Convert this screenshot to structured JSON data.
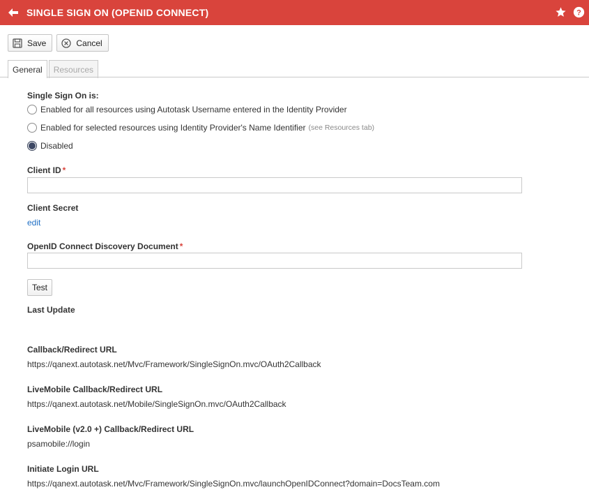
{
  "header": {
    "title": "SINGLE SIGN ON (OPENID CONNECT)",
    "icons": [
      "back-arrow-icon",
      "star-icon",
      "help-icon"
    ],
    "color": "#d9443c"
  },
  "toolbar": {
    "save_label": "Save",
    "cancel_label": "Cancel"
  },
  "tabs": [
    {
      "label": "General",
      "active": true
    },
    {
      "label": "Resources",
      "active": false
    }
  ],
  "sso": {
    "heading": "Single Sign On is:",
    "options": [
      {
        "label": "Enabled for all resources using Autotask Username entered in the Identity Provider",
        "hint": "",
        "checked": false
      },
      {
        "label": "Enabled for selected resources using Identity Provider's Name Identifier",
        "hint": "(see Resources tab)",
        "checked": false
      },
      {
        "label": "Disabled",
        "hint": "",
        "checked": true
      }
    ]
  },
  "client_id": {
    "label": "Client ID",
    "required": "*",
    "value": ""
  },
  "client_secret": {
    "label": "Client Secret",
    "edit_label": "edit"
  },
  "discovery": {
    "label": "OpenID Connect Discovery Document",
    "required": "*",
    "value": "",
    "test_label": "Test"
  },
  "last_update": {
    "label": "Last Update",
    "value": ""
  },
  "callback": {
    "label": "Callback/Redirect URL",
    "value": "https://qanext.autotask.net/Mvc/Framework/SingleSignOn.mvc/OAuth2Callback"
  },
  "livemobile_callback": {
    "label": "LiveMobile Callback/Redirect URL",
    "value": "https://qanext.autotask.net/Mobile/SingleSignOn.mvc/OAuth2Callback"
  },
  "livemobile_v2_callback": {
    "label": "LiveMobile (v2.0 +) Callback/Redirect URL",
    "value": "psamobile://login"
  },
  "initiate_login": {
    "label": "Initiate Login URL",
    "value": "https://qanext.autotask.net/Mvc/Framework/SingleSignOn.mvc/launchOpenIDConnect?domain=DocsTeam.com"
  }
}
